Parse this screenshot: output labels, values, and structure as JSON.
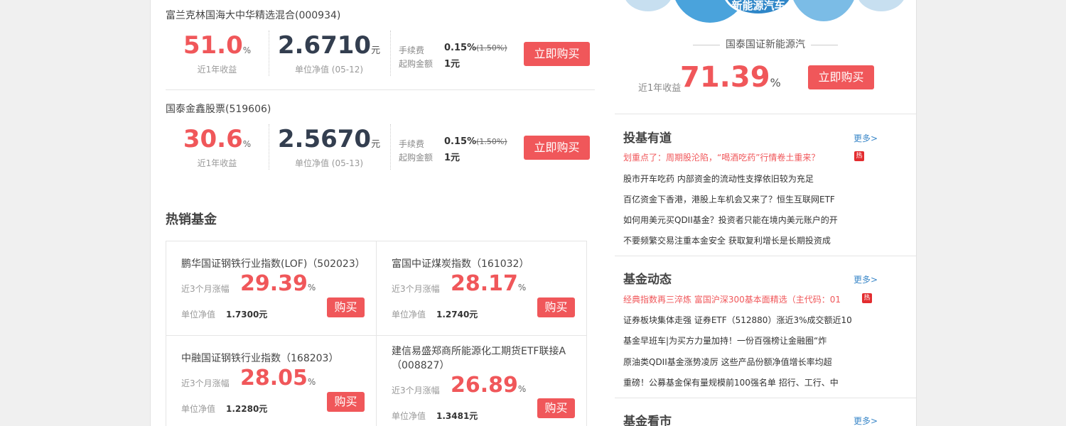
{
  "top_funds": [
    {
      "name": "富兰克林国海大中华精选混合(000934)",
      "return_value": "51.0",
      "return_pct": "%",
      "return_label": "近1年收益",
      "nav_value": "2.6710",
      "nav_unit": "元",
      "nav_label": "单位净值 (05-12)",
      "fee_label": "手续费",
      "fee_value": "0.15%",
      "fee_old": "(1.50%)",
      "min_label": "起购金额",
      "min_value": "1元",
      "buy_label": "立即购买"
    },
    {
      "name": "国泰金鑫股票(519606)",
      "return_value": "30.6",
      "return_pct": "%",
      "return_label": "近1年收益",
      "nav_value": "2.5670",
      "nav_unit": "元",
      "nav_label": "单位净值 (05-13)",
      "fee_label": "手续费",
      "fee_value": "0.15%",
      "fee_old": "(1.50%)",
      "min_label": "起购金额",
      "min_value": "1元",
      "buy_label": "立即购买"
    }
  ],
  "hot": {
    "title": "热销基金",
    "funds": [
      {
        "name": "鹏华国证钢铁行业指数(LOF)（502023）",
        "change_label": "近3个月涨幅",
        "change_value": "29.39",
        "pct": "%",
        "nav_label": "单位净值",
        "nav_value": "1.7300元",
        "buy_label": "购买"
      },
      {
        "name": "富国中证煤炭指数（161032）",
        "change_label": "近3个月涨幅",
        "change_value": "28.17",
        "pct": "%",
        "nav_label": "单位净值",
        "nav_value": "1.2740元",
        "buy_label": "购买"
      },
      {
        "name": "中融国证钢铁行业指数（168203）",
        "change_label": "近3个月涨幅",
        "change_value": "28.05",
        "pct": "%",
        "nav_label": "单位净值",
        "nav_value": "1.2280元",
        "buy_label": "购买"
      },
      {
        "name": "建信易盛郑商所能源化工期货ETF联接A（008827）",
        "change_label": "近3个月涨幅",
        "change_value": "26.89",
        "pct": "%",
        "nav_label": "单位净值",
        "nav_value": "1.3481元",
        "buy_label": "购买"
      }
    ]
  },
  "featured": {
    "bubble_text": "新能源汽车",
    "name": "国泰国证新能源汽",
    "return_label": "近1年收益",
    "return_value": "71.39",
    "return_pct": "%",
    "buy_label": "立即购买"
  },
  "news_sections": [
    {
      "title": "投基有道",
      "more": "更多>",
      "items": [
        "划重点了：周期股沦陷，“喝酒吃药”行情卷土重来？",
        "股市开车吃药 内部资金的流动性支撑依旧较为充足",
        "百亿资金下香港，港股上车机会又来了？恒生互联网ETF",
        "如何用美元买QDII基金？投资者只能在境内美元账户的开",
        "不要频繁交易注重本金安全 获取复利增长是长期投资成"
      ],
      "hot_badge": "热"
    },
    {
      "title": "基金动态",
      "more": "更多>",
      "items": [
        "经典指数再三淬炼 富国沪深300基本面精选（主代码：01",
        "证券板块集体走强 证券ETF（512880）涨近3%成交额近10",
        "基金早班车|为买方力量加持！一份百强榜让金融圈“炸",
        "原油类QDII基金涨势凌厉 这些产品份额净值增长率均超",
        "重磅！公募基金保有量规模前100强名单 招行、工行、中"
      ],
      "hot_badge": "热"
    },
    {
      "title": "基金看市",
      "more": "更多>"
    }
  ],
  "colors": {
    "accent_red": "#f0575a",
    "link_blue": "#3a87c8",
    "bubble_blue": "#4aa3dc"
  }
}
